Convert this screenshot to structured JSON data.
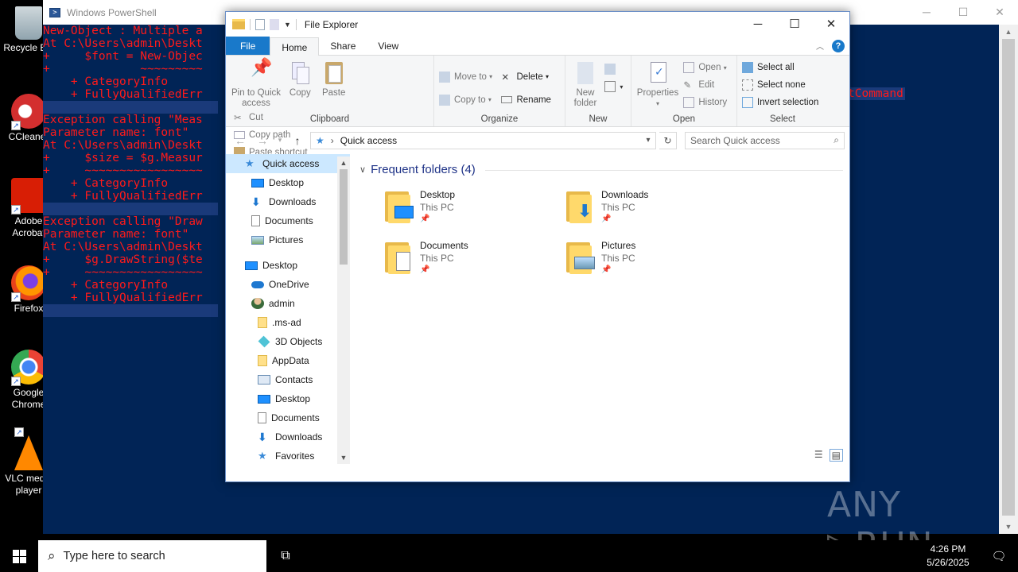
{
  "desktop": {
    "icons": [
      {
        "label": "Recycle Bin"
      },
      {
        "label": "CCleaner"
      },
      {
        "label": "Adobe Acrobat"
      },
      {
        "label": "Firefox"
      },
      {
        "label": "Google Chrome"
      },
      {
        "label": "VLC media player"
      }
    ]
  },
  "powershell": {
    "title": "Windows PowerShell",
    "lines": [
      "New-Object : Multiple a",
      "At C:\\Users\\admin\\Deskt",
      "+     $font = New-Objec",
      "+             ~~~~~~~~~",
      "    + CategoryInfo",
      "    + FullyQualifiedErr",
      "",
      "Exception calling \"Meas",
      "Parameter name: font\"",
      "At C:\\Users\\admin\\Deskt",
      "+     $size = $g.Measur",
      "+     ~~~~~~~~~~~~~~~~~",
      "    + CategoryInfo",
      "    + FullyQualifiedErr",
      "",
      "Exception calling \"Draw",
      "Parameter name: font\"",
      "At C:\\Users\\admin\\Deskt",
      "+     $g.DrawString($te",
      "+     ~~~~~~~~~~~~~~~~~",
      "    + CategoryInfo",
      "    + FullyQualifiedErr",
      ""
    ],
    "tail_text": "tCommand"
  },
  "explorer": {
    "title": "File Explorer",
    "tabs": {
      "file": "File",
      "home": "Home",
      "share": "Share",
      "view": "View"
    },
    "ribbon": {
      "clipboard": {
        "label": "Clipboard",
        "pin": "Pin to Quick access",
        "copy": "Copy",
        "paste": "Paste",
        "cut": "Cut",
        "copy_path": "Copy path",
        "paste_shortcut": "Paste shortcut"
      },
      "organize": {
        "label": "Organize",
        "move_to": "Move to",
        "copy_to": "Copy to",
        "delete": "Delete",
        "rename": "Rename"
      },
      "new": {
        "label": "New",
        "new_folder": "New folder"
      },
      "open": {
        "label": "Open",
        "properties": "Properties",
        "open": "Open",
        "edit": "Edit",
        "history": "History"
      },
      "select": {
        "label": "Select",
        "select_all": "Select all",
        "select_none": "Select none",
        "invert": "Invert selection"
      }
    },
    "address": {
      "path": "Quick access",
      "search_placeholder": "Search Quick access"
    },
    "nav": [
      {
        "label": "Quick access",
        "indent": 0,
        "selected": true,
        "icon": "star-icon"
      },
      {
        "label": "Desktop",
        "indent": 1,
        "pinned": true,
        "icon": "desktop-icon"
      },
      {
        "label": "Downloads",
        "indent": 1,
        "pinned": true,
        "icon": "download-icon"
      },
      {
        "label": "Documents",
        "indent": 1,
        "pinned": true,
        "icon": "document-icon"
      },
      {
        "label": "Pictures",
        "indent": 1,
        "pinned": true,
        "icon": "picture-icon"
      },
      {
        "label": "Desktop",
        "indent": 0,
        "icon": "desktop-icon",
        "gap": true
      },
      {
        "label": "OneDrive",
        "indent": 1,
        "icon": "cloud-icon"
      },
      {
        "label": "admin",
        "indent": 1,
        "icon": "user-icon"
      },
      {
        "label": ".ms-ad",
        "indent": 2,
        "icon": "folder-icon"
      },
      {
        "label": "3D Objects",
        "indent": 2,
        "icon": "cube-icon"
      },
      {
        "label": "AppData",
        "indent": 2,
        "icon": "folder-icon"
      },
      {
        "label": "Contacts",
        "indent": 2,
        "icon": "contacts-icon"
      },
      {
        "label": "Desktop",
        "indent": 2,
        "icon": "desktop-icon"
      },
      {
        "label": "Documents",
        "indent": 2,
        "icon": "document-icon"
      },
      {
        "label": "Downloads",
        "indent": 2,
        "icon": "download-icon"
      },
      {
        "label": "Favorites",
        "indent": 2,
        "icon": "star-icon"
      }
    ],
    "frequent": {
      "heading": "Frequent folders (4)",
      "items": [
        {
          "name": "Desktop",
          "location": "This PC",
          "overlay": "desktop"
        },
        {
          "name": "Downloads",
          "location": "This PC",
          "overlay": "download"
        },
        {
          "name": "Documents",
          "location": "This PC",
          "overlay": "document"
        },
        {
          "name": "Pictures",
          "location": "This PC",
          "overlay": "picture"
        }
      ]
    }
  },
  "taskbar": {
    "search_placeholder": "Type here to search",
    "time": "4:26 PM",
    "date": "5/26/2025"
  },
  "watermark": "ANY RUN",
  "colors": {
    "ps_bg": "#012456",
    "ps_text": "#ff1a1a",
    "accent": "#1979ca",
    "folder_heading": "#1e3287"
  }
}
